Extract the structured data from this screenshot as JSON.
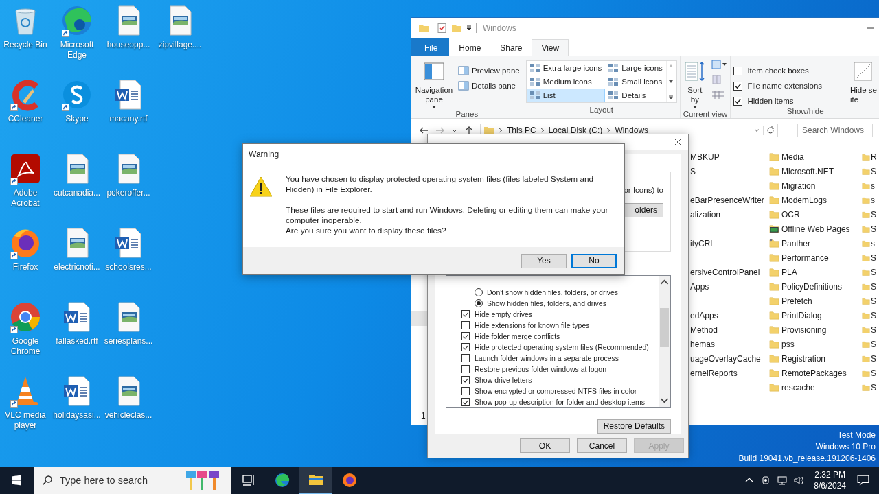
{
  "desktop_icons": [
    {
      "label": "Recycle Bin",
      "kind": "recycle",
      "shortcut": false
    },
    {
      "label": "CCleaner",
      "kind": "ccleaner",
      "shortcut": true
    },
    {
      "label": "Adobe Acrobat",
      "kind": "acrobat",
      "shortcut": true
    },
    {
      "label": "Firefox",
      "kind": "firefox",
      "shortcut": true
    },
    {
      "label": "Google Chrome",
      "kind": "chrome",
      "shortcut": true
    },
    {
      "label": "VLC media player",
      "kind": "vlc",
      "shortcut": true
    },
    {
      "label": "Microsoft Edge",
      "kind": "edge",
      "shortcut": true
    },
    {
      "label": "Skype",
      "kind": "skype",
      "shortcut": true
    },
    {
      "label": "cutcanadia...",
      "kind": "image",
      "shortcut": false
    },
    {
      "label": "electricnoti...",
      "kind": "image",
      "shortcut": false
    },
    {
      "label": "fallasked.rtf",
      "kind": "word",
      "shortcut": false
    },
    {
      "label": "holidaysasi...",
      "kind": "word",
      "shortcut": false
    },
    {
      "label": "houseopp...",
      "kind": "image",
      "shortcut": false
    },
    {
      "label": "macany.rtf",
      "kind": "word",
      "shortcut": false
    },
    {
      "label": "pokeroffer...",
      "kind": "image",
      "shortcut": false
    },
    {
      "label": "schoolsres...",
      "kind": "word",
      "shortcut": false
    },
    {
      "label": "seriesplans...",
      "kind": "image",
      "shortcut": false
    },
    {
      "label": "vehicleclas...",
      "kind": "image",
      "shortcut": false
    },
    {
      "label": "zipvillage....",
      "kind": "image",
      "shortcut": false
    }
  ],
  "os_info": [
    "Test Mode",
    "Windows 10 Pro",
    "Build 19041.vb_release.191206-1406"
  ],
  "explorer": {
    "title": "Windows",
    "tabs": [
      {
        "label": "File",
        "kind": "file",
        "selected": false
      },
      {
        "label": "Home",
        "kind": "tab",
        "selected": false
      },
      {
        "label": "Share",
        "kind": "tab",
        "selected": false
      },
      {
        "label": "View",
        "kind": "tab",
        "selected": true
      }
    ],
    "ribbon": {
      "panes": {
        "label": "Panes",
        "navigation_pane": "Navigation pane",
        "items": [
          "Preview pane",
          "Details pane"
        ]
      },
      "layout": {
        "label": "Layout",
        "options": [
          {
            "label": "Extra large icons",
            "selected": false
          },
          {
            "label": "Large icons",
            "selected": false
          },
          {
            "label": "Medium icons",
            "selected": false
          },
          {
            "label": "Small icons",
            "selected": false
          },
          {
            "label": "List",
            "selected": true
          },
          {
            "label": "Details",
            "selected": false
          }
        ]
      },
      "current_view": {
        "label": "Current view",
        "sort_by": "Sort by"
      },
      "show_hide": {
        "label": "Show/hide",
        "options": [
          {
            "label": "Item check boxes",
            "checked": false
          },
          {
            "label": "File name extensions",
            "checked": true
          },
          {
            "label": "Hidden items",
            "checked": true
          }
        ],
        "hide_selected": [
          "Hide se",
          "ite"
        ]
      }
    },
    "address": [
      "This PC",
      "Local Disk (C:)",
      "Windows"
    ],
    "search": {
      "placeholder": "Search Windows"
    },
    "files": {
      "column_1": [
        [
          "MBKUP",
          "S"
        ],
        [
          "eBarPresenceWriter",
          "alization"
        ],
        [
          "ityCRL"
        ],
        [
          "ersiveControlPanel",
          "Apps"
        ],
        [
          "edApps",
          "Method",
          "hemas",
          "uageOverlayCache",
          "ernelReports"
        ]
      ],
      "column_2": [
        {
          "name": "Media",
          "kind": "folder"
        },
        {
          "name": "Microsoft.NET",
          "kind": "folder"
        },
        {
          "name": "Migration",
          "kind": "folder"
        },
        {
          "name": "ModemLogs",
          "kind": "folder"
        },
        {
          "name": "OCR",
          "kind": "folder"
        },
        {
          "name": "Offline Web Pages",
          "kind": "offline"
        },
        {
          "name": "Panther",
          "kind": "panther"
        },
        {
          "name": "Performance",
          "kind": "folder"
        },
        {
          "name": "PLA",
          "kind": "folder"
        },
        {
          "name": "PolicyDefinitions",
          "kind": "folder"
        },
        {
          "name": "Prefetch",
          "kind": "folder"
        },
        {
          "name": "PrintDialog",
          "kind": "folder"
        },
        {
          "name": "Provisioning",
          "kind": "folder"
        },
        {
          "name": "pss",
          "kind": "folder"
        },
        {
          "name": "Registration",
          "kind": "folder"
        },
        {
          "name": "RemotePackages",
          "kind": "folder"
        },
        {
          "name": "rescache",
          "kind": "folder"
        }
      ],
      "column_3": [
        "R",
        "S",
        "s",
        "s",
        "S",
        "S",
        "s",
        "S",
        "S",
        "S",
        "S",
        "S",
        "S",
        "S",
        "S",
        "S",
        "S"
      ]
    },
    "item_count": "1"
  },
  "folder_options": {
    "group_text": "or Icons) to",
    "apply_button": "olders",
    "advanced": [
      {
        "kind": "radio",
        "label": "Don't show hidden files, folders, or drives",
        "selected": false
      },
      {
        "kind": "radio",
        "label": "Show hidden files, folders, and drives",
        "selected": true
      },
      {
        "kind": "check",
        "label": "Hide empty drives",
        "checked": true
      },
      {
        "kind": "check",
        "label": "Hide extensions for known file types",
        "checked": false
      },
      {
        "kind": "check",
        "label": "Hide folder merge conflicts",
        "checked": true
      },
      {
        "kind": "check",
        "label": "Hide protected operating system files (Recommended)",
        "checked": true
      },
      {
        "kind": "check",
        "label": "Launch folder windows in a separate process",
        "checked": false
      },
      {
        "kind": "check",
        "label": "Restore previous folder windows at logon",
        "checked": false
      },
      {
        "kind": "check",
        "label": "Show drive letters",
        "checked": true
      },
      {
        "kind": "check",
        "label": "Show encrypted or compressed NTFS files in color",
        "checked": false
      },
      {
        "kind": "check",
        "label": "Show pop-up description for folder and desktop items",
        "checked": true
      }
    ],
    "restore_defaults": "Restore Defaults",
    "buttons": [
      {
        "label": "OK",
        "disabled": false
      },
      {
        "label": "Cancel",
        "disabled": false
      },
      {
        "label": "Apply",
        "disabled": true
      }
    ]
  },
  "warning": {
    "title": "Warning",
    "paragraphs": [
      "You have chosen to display protected operating system files (files labeled System and Hidden) in File Explorer.",
      "These files are required to start and run Windows. Deleting or editing them can make your computer inoperable.",
      "Are you sure you want to display these files?"
    ],
    "buttons": [
      {
        "label": "Yes",
        "focused": false
      },
      {
        "label": "No",
        "focused": true
      }
    ]
  },
  "taskbar": {
    "search_placeholder": "Type here to search",
    "apps": [
      {
        "kind": "taskview",
        "active": false
      },
      {
        "kind": "edge",
        "active": false
      },
      {
        "kind": "explorer",
        "active": true
      },
      {
        "kind": "firefox",
        "active": false
      }
    ],
    "time": "2:32 PM",
    "date": "8/6/2024"
  }
}
